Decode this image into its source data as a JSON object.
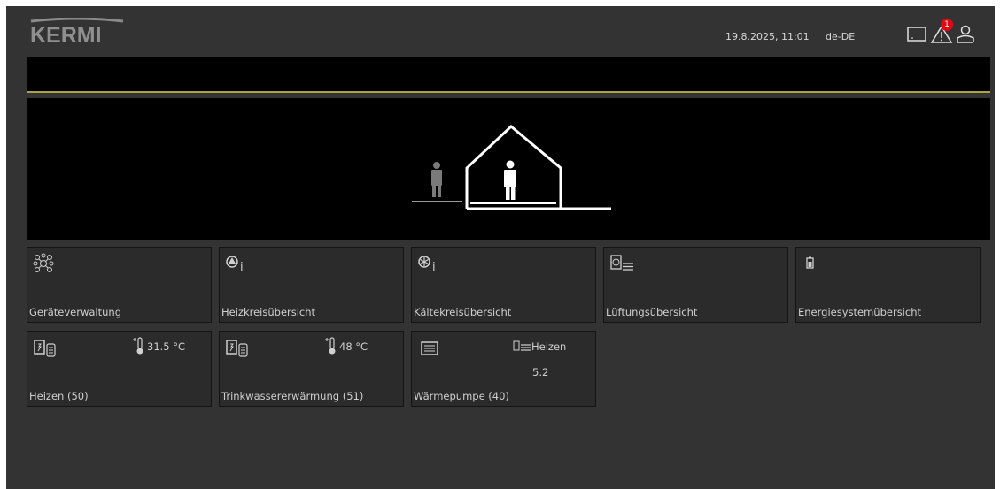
{
  "header": {
    "brand": "KERMI",
    "datetime": "19.8.2025, 11:01",
    "locale": "de-DE",
    "alert_count": "1",
    "icons": [
      "display-icon",
      "warning-icon",
      "user-icon"
    ]
  },
  "colors": {
    "background": "#333333",
    "tile": "#2b2b2b",
    "accent_line": "#a6a73f",
    "badge": "#e30613"
  },
  "tiles_row1": [
    {
      "label": "Geräteverwaltung",
      "icon": "device-network-icon"
    },
    {
      "label": "Heizkreisübersicht",
      "icon": "heating-circuit-icon"
    },
    {
      "label": "Kältekreisübersicht",
      "icon": "cooling-circuit-icon"
    },
    {
      "label": "Lüftungsübersicht",
      "icon": "ventilation-icon"
    },
    {
      "label": "Energiesystemübersicht",
      "icon": "battery-icon"
    }
  ],
  "tiles_row2": [
    {
      "label": "Heizen (50)",
      "icon": "buffer-tank-icon",
      "temperature": "31.5 °C"
    },
    {
      "label": "Trinkwassererwärmung (51)",
      "icon": "water-tank-icon",
      "temperature": "48 °C"
    },
    {
      "label": "Wärmepumpe (40)",
      "icon": "heat-pump-icon",
      "mode": "Heizen",
      "value": "5.2"
    }
  ]
}
